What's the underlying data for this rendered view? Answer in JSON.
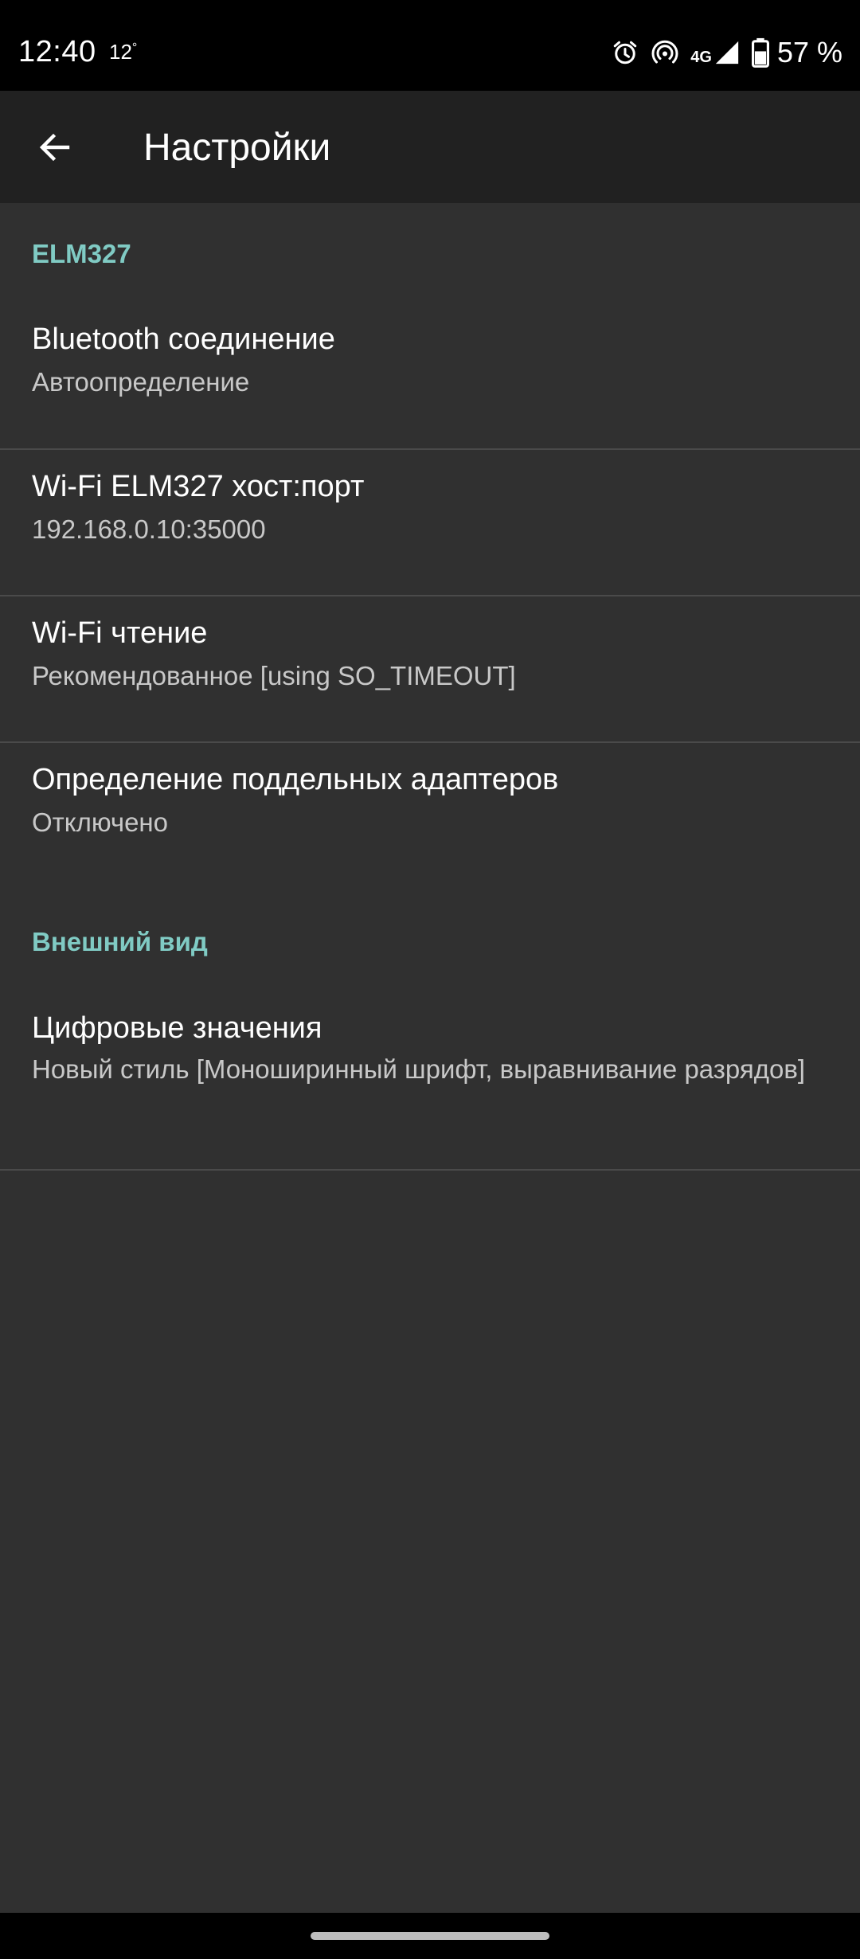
{
  "status_bar": {
    "time": "12:40",
    "temperature": "12",
    "temperature_unit": "°",
    "network_type": "4G",
    "battery": "57 %",
    "icons": [
      "alarm-icon",
      "hotspot-icon",
      "signal-icon",
      "battery-icon"
    ]
  },
  "app_bar": {
    "title": "Настройки",
    "back_icon": "arrow-back-icon"
  },
  "sections": {
    "elm327": {
      "header": "ELM327",
      "items": [
        {
          "title": "Bluetooth соединение",
          "summary": "Автоопределение"
        },
        {
          "title": "Wi-Fi ELM327 хост:порт",
          "summary": "192.168.0.10:35000"
        },
        {
          "title": "Wi-Fi чтение",
          "summary": "Рекомендованное [using SO_TIMEOUT]"
        },
        {
          "title": "Определение поддельных адаптеров",
          "summary": "Отключено"
        }
      ]
    },
    "appearance": {
      "header": "Внешний вид",
      "items": [
        {
          "title": "Цифровые значения",
          "summary": "Новый стиль [Моноширинный шрифт, выравнивание разрядов]"
        }
      ]
    }
  },
  "colors": {
    "accent": "#80cbc4",
    "background": "#303030",
    "app_bar": "#212121",
    "status_bar": "#000000"
  }
}
